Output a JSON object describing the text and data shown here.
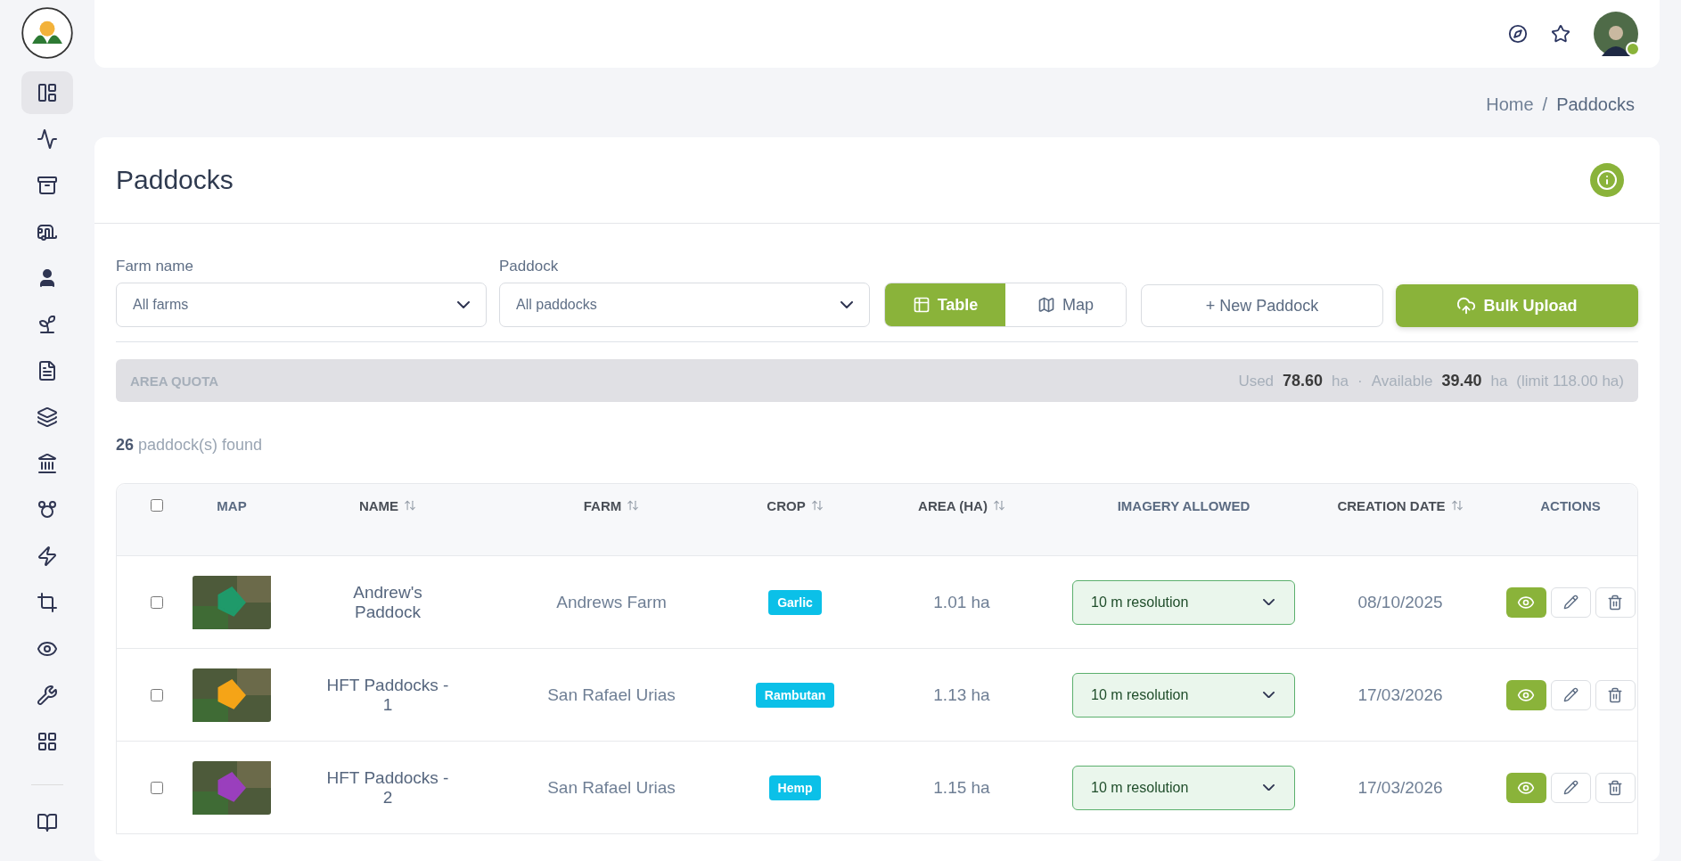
{
  "sidebar": {
    "items": [
      {
        "selected": true
      },
      {
        "selected": false
      },
      {
        "selected": false
      },
      {
        "selected": false
      },
      {
        "selected": false
      },
      {
        "selected": false
      },
      {
        "selected": false
      },
      {
        "selected": false
      },
      {
        "selected": false
      },
      {
        "selected": false
      },
      {
        "selected": false
      },
      {
        "selected": false
      },
      {
        "selected": false
      },
      {
        "selected": false
      },
      {
        "selected": false
      }
    ],
    "footer_items": [
      {
        "selected": false
      }
    ]
  },
  "header": {
    "avatar": {
      "online": true
    }
  },
  "breadcrumb": {
    "separator": "/",
    "items": [
      "Home",
      "Paddocks"
    ]
  },
  "page": {
    "title": "Paddocks"
  },
  "filters": [
    {
      "label": "Farm name",
      "value": "All farms"
    },
    {
      "label": "Paddock",
      "value": "All paddocks"
    }
  ],
  "view_modes": [
    {
      "label": "Table",
      "selected": true
    },
    {
      "label": "Map",
      "selected": false
    }
  ],
  "buttons": {
    "new": "+ New Paddock",
    "upload": "Bulk Upload"
  },
  "quota": {
    "label": "AREA QUOTA",
    "used_label": "Used",
    "used_value": "78.60",
    "used_unit": "ha",
    "separator": "·",
    "available_label": "Available",
    "available_value": "39.40",
    "available_unit": "ha",
    "limit": "(limit 118.00 ha)"
  },
  "count": "**26** paddock(s) found",
  "table": {
    "select_all": {
      "checked": false
    },
    "columns": [
      {
        "label": "MAP",
        "sortable": false
      },
      {
        "label": "NAME",
        "sortable": true
      },
      {
        "label": "FARM",
        "sortable": true
      },
      {
        "label": "CROP",
        "sortable": true
      },
      {
        "label": "AREA (HA)",
        "sortable": true
      },
      {
        "label": "IMAGERY ALLOWED",
        "sortable": false
      },
      {
        "label": "CREATION DATE",
        "sortable": true
      },
      {
        "label": "ACTIONS",
        "sortable": false
      }
    ],
    "rows": [
      {
        "checked": false,
        "color": "#1f9a6a",
        "name": "Andrew's Paddock",
        "farm": "Andrews Farm",
        "crop": "Garlic",
        "area": "1.01 ha",
        "imagery": "10 m resolution",
        "date": "08/10/2025"
      },
      {
        "checked": false,
        "color": "#f5a417",
        "name": "HFT Paddocks - 1",
        "farm": "San Rafael Urias",
        "crop": "Rambutan",
        "area": "1.13 ha",
        "imagery": "10 m resolution",
        "date": "17/03/2026"
      },
      {
        "checked": false,
        "color": "#9a3fbd",
        "name": "HFT Paddocks - 2",
        "farm": "San Rafael Urias",
        "crop": "Hemp",
        "area": "1.15 ha",
        "imagery": "10 m resolution",
        "date": "17/03/2026"
      }
    ]
  }
}
